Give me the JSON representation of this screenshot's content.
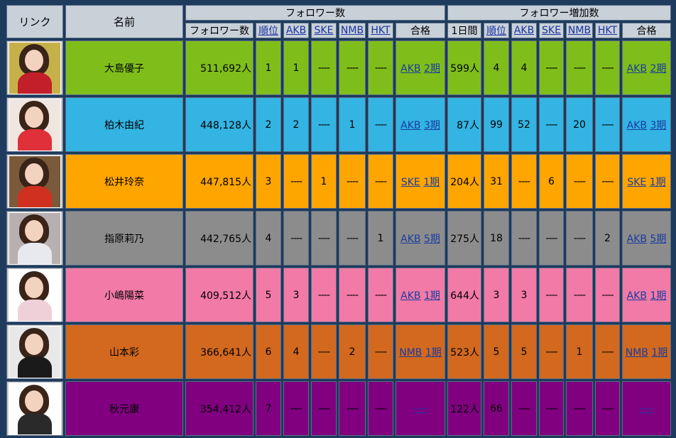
{
  "header": {
    "link": "リンク",
    "name": "名前",
    "followers_group": "フォロワー数",
    "increase_group": "フォロワー増加数",
    "followers": "フォロワー数",
    "rank": "順位",
    "akb": "AKB",
    "ske": "SKE",
    "nmb": "NMB",
    "hkt": "HKT",
    "pass": "合格",
    "daily": "1日間"
  },
  "rows": [
    {
      "name": "大島優子",
      "followers": "511,692人",
      "rank": "1",
      "akb": "1",
      "ske": "----",
      "nmb": "----",
      "hkt": "----",
      "pass_grp": "AKB",
      "pass_gen": "2期",
      "daily": "599人",
      "inc_rank": "4",
      "inc_akb": "4",
      "inc_ske": "----",
      "inc_nmb": "----",
      "inc_hkt": "----",
      "inc_pass_grp": "AKB",
      "inc_pass_gen": "2期",
      "bg": "#7fbe1a",
      "thumb_bg": "#c6b04a",
      "thumb_body": "#c21f2a"
    },
    {
      "name": "柏木由紀",
      "followers": "448,128人",
      "rank": "2",
      "akb": "2",
      "ske": "----",
      "nmb": "1",
      "hkt": "----",
      "pass_grp": "AKB",
      "pass_gen": "3期",
      "daily": "87人",
      "inc_rank": "99",
      "inc_akb": "52",
      "inc_ske": "----",
      "inc_nmb": "20",
      "inc_hkt": "----",
      "inc_pass_grp": "AKB",
      "inc_pass_gen": "3期",
      "bg": "#33b4e3",
      "thumb_bg": "#f0e6e0",
      "thumb_body": "#e0303a"
    },
    {
      "name": "松井玲奈",
      "followers": "447,815人",
      "rank": "3",
      "akb": "----",
      "ske": "1",
      "nmb": "----",
      "hkt": "----",
      "pass_grp": "SKE",
      "pass_gen": "1期",
      "daily": "204人",
      "inc_rank": "31",
      "inc_akb": "----",
      "inc_ske": "6",
      "inc_nmb": "----",
      "inc_hkt": "----",
      "inc_pass_grp": "SKE",
      "inc_pass_gen": "1期",
      "bg": "#ffa500",
      "thumb_bg": "#7a5a3a",
      "thumb_body": "#d03020"
    },
    {
      "name": "指原莉乃",
      "followers": "442,765人",
      "rank": "4",
      "akb": "----",
      "ske": "----",
      "nmb": "----",
      "hkt": "1",
      "pass_grp": "AKB",
      "pass_gen": "5期",
      "daily": "275人",
      "inc_rank": "18",
      "inc_akb": "----",
      "inc_ske": "----",
      "inc_nmb": "----",
      "inc_hkt": "2",
      "inc_pass_grp": "AKB",
      "inc_pass_gen": "5期",
      "bg": "#8c8c8c",
      "thumb_bg": "#b8b0b0",
      "thumb_body": "#e8e8ef"
    },
    {
      "name": "小嶋陽菜",
      "followers": "409,512人",
      "rank": "5",
      "akb": "3",
      "ske": "----",
      "nmb": "----",
      "hkt": "----",
      "pass_grp": "AKB",
      "pass_gen": "1期",
      "daily": "644人",
      "inc_rank": "3",
      "inc_akb": "3",
      "inc_ske": "----",
      "inc_nmb": "----",
      "inc_hkt": "----",
      "inc_pass_grp": "AKB",
      "inc_pass_gen": "1期",
      "bg": "#f27aa6",
      "thumb_bg": "#ffffff",
      "thumb_body": "#f0d0d8"
    },
    {
      "name": "山本彩",
      "followers": "366,641人",
      "rank": "6",
      "akb": "4",
      "ske": "----",
      "nmb": "2",
      "hkt": "----",
      "pass_grp": "NMB",
      "pass_gen": "1期",
      "daily": "523人",
      "inc_rank": "5",
      "inc_akb": "5",
      "inc_ske": "----",
      "inc_nmb": "1",
      "inc_hkt": "----",
      "inc_pass_grp": "NMB",
      "inc_pass_gen": "1期",
      "bg": "#d2691e",
      "thumb_bg": "#e8e8e8",
      "thumb_body": "#1a1a1a"
    },
    {
      "name": "秋元康",
      "followers": "354,412人",
      "rank": "7",
      "akb": "----",
      "ske": "----",
      "nmb": "----",
      "hkt": "----",
      "pass_grp": "",
      "pass_gen": "----",
      "daily": "122人",
      "inc_rank": "66",
      "inc_akb": "----",
      "inc_ske": "----",
      "inc_nmb": "----",
      "inc_hkt": "----",
      "inc_pass_grp": "",
      "inc_pass_gen": "----",
      "bg": "#800080",
      "thumb_bg": "#ffffff",
      "thumb_body": "#2a2a2a"
    }
  ]
}
